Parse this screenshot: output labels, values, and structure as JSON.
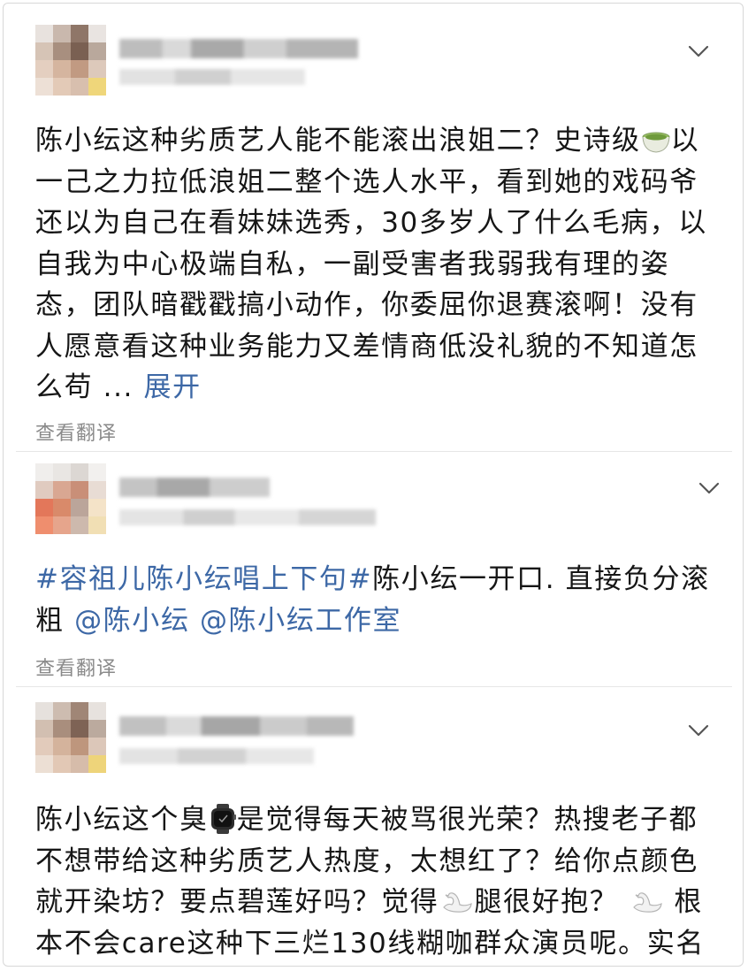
{
  "posts": [
    {
      "text": "陈小纭这种劣质艺人能不能滚出浪姐二？史诗级🍵以一己之力拉低浪姐二整个选人水平，看到她的戏码爷还以为自己在看妹妹选秀，30多岁人了什么毛病，以自我为中心极端自私，一副受害者我弱我有理的姿态，团队暗戳戳搞小动作，你委屈你退赛滚啊！没有人愿意看这种业务能力又差情商低没礼貌的不知道怎么苟 ... ",
      "expand_label": "展开",
      "translate_label": "查看翻译"
    },
    {
      "hashtag": "#容祖儿陈小纭唱上下句#",
      "text_after_hashtag": "陈小纭一开口. 直接负分滚粗 ",
      "mention1": "@陈小纭",
      "mention2": "@陈小纭工作室",
      "translate_label": "查看翻译"
    },
    {
      "text_part1": "陈小纭这个臭",
      "text_part2": "是觉得每天被骂很光荣？热搜老子都不想带给这种劣质艺人热度，太想红了？给你点颜色就开染坊？要点碧莲好吗？觉得",
      "text_part3": "腿很好抱？",
      "text_part4": "根本不会care这种下三烂130线糊咖群众演员呢。实名"
    }
  ],
  "icons": {
    "menu": "chevron-down-icon",
    "tea": "tea-emoji",
    "watch": "watch-emoji",
    "swan": "swan-emoji"
  },
  "colors": {
    "link": "#3d68a6",
    "meta": "#8a8a8a"
  }
}
